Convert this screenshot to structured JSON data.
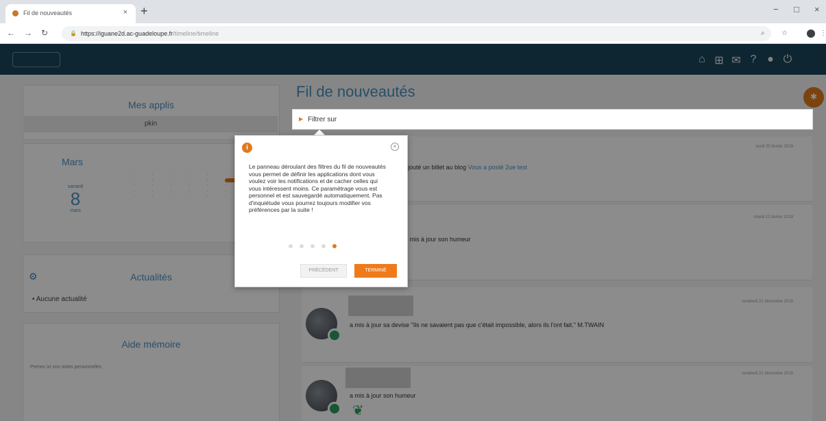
{
  "browser": {
    "tab_title": "Fil de nouveautés",
    "tab_close": "×",
    "new_tab": "+",
    "url_host": "https://iguane2d.ac-guadeloupe.fr",
    "url_path": "/timeline/timeline",
    "window_controls": [
      "−",
      "□",
      "×"
    ]
  },
  "left": {
    "apps_title": "Mes applis",
    "apps_item": "pkin",
    "calendar_month": "Mars",
    "day_name": "samedi",
    "day_number": "8",
    "day_month": "mars",
    "news_title": "Actualités",
    "news_item": "Aucune actualité",
    "memo_title": "Aide mémoire",
    "memo_placeholder": "Prenez ici vos notes personnelles"
  },
  "feed": {
    "title": "Fil de nouveautés",
    "filter_label": "Filtrer sur",
    "items": [
      {
        "date": "lundi 25 février 2019",
        "text": "ajouté un billet au blog",
        "link": "Vous a posté 2ue test"
      },
      {
        "date": "mardi 12 février 2019",
        "text": "a mis à jour son humeur"
      },
      {
        "date": "vendredi 21 décembre 2018",
        "text": "a mis à jour sa devise \"Ils ne savaient pas que c'était impossible, alors ils l'ont fait.\" M.TWAIN"
      },
      {
        "date": "vendredi 21 décembre 2018",
        "text": "a mis à jour son humeur"
      }
    ]
  },
  "tutorial": {
    "text": "Le panneau déroulant des filtres du fil de nouveautés vous permet de définir les applications dont vous voulez voir les notifications et de cacher celles qui vous intéressent moins. Ce paramétrage vous est personnel et est sauvegardé automatiquement. Pas d'inquiétude vous pourrez toujours modifier vos préférences par la suite !",
    "steps_total": 5,
    "current_step": 5,
    "prev_label": "PRÉCÉDENT",
    "end_label": "TERMINÉ",
    "close_label": "×",
    "info_label": "i"
  },
  "colors": {
    "header": "#19465a",
    "accent": "#e07a1c",
    "title_blue": "#4a90c2"
  },
  "icons": {
    "header": [
      "home-icon",
      "apps-grid-icon",
      "mail-icon",
      "help-icon",
      "user-icon",
      "power-icon"
    ]
  }
}
